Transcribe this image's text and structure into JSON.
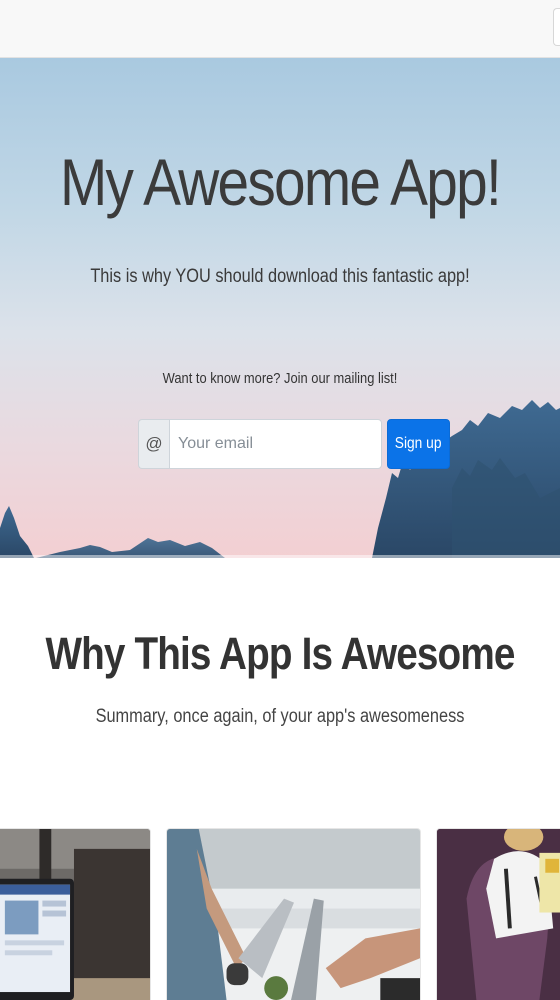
{
  "hero": {
    "title": "My Awesome App!",
    "subtitle": "This is why YOU should download this fantastic app!",
    "cta_text": "Want to know more? Join our mailing list!",
    "form": {
      "addon_symbol": "@",
      "email_placeholder": "Your email",
      "email_value": "",
      "submit_label": "Sign up"
    }
  },
  "features": {
    "title": "Why This App Is Awesome",
    "subtitle": "Summary, once again, of your app's awesomeness"
  },
  "cards": [
    {
      "image": "laptop-desk-photo"
    },
    {
      "image": "people-laptops-photo"
    },
    {
      "image": "person-chair-photo"
    }
  ],
  "colors": {
    "primary_button": "#0b73e8",
    "hero_sky_top": "#a9c9e0",
    "hero_sky_bottom": "#f3cfd2",
    "mountain": "#34587c"
  }
}
